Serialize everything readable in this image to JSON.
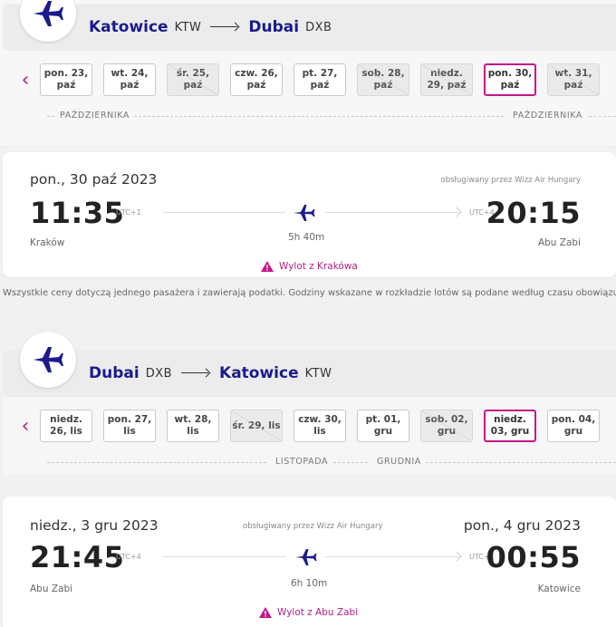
{
  "outbound": {
    "route": {
      "from_city": "Katowice",
      "from_code": "KTW",
      "to_city": "Dubai",
      "to_code": "DXB"
    },
    "days": [
      {
        "l1": "pon. 23,",
        "l2": "paź",
        "state": "normal"
      },
      {
        "l1": "wt. 24,",
        "l2": "paź",
        "state": "normal"
      },
      {
        "l1": "śr. 25,",
        "l2": "paź",
        "state": "disabled"
      },
      {
        "l1": "czw. 26,",
        "l2": "paź",
        "state": "normal"
      },
      {
        "l1": "pt. 27,",
        "l2": "paź",
        "state": "normal"
      },
      {
        "l1": "sob. 28,",
        "l2": "paź",
        "state": "disabled"
      },
      {
        "l1": "niedz.",
        "l2": "29, paź",
        "state": "disabled"
      },
      {
        "l1": "pon. 30,",
        "l2": "paź",
        "state": "selected"
      },
      {
        "l1": "wt. 31,",
        "l2": "paź",
        "state": "disabled"
      }
    ],
    "month_left": "PAŹDZIERNIKA",
    "month_right": "PAŹDZIERNIKA",
    "flight": {
      "date": "pon., 30 paź 2023",
      "operated_by": "obsługiwany przez Wizz Air Hungary",
      "dep_time": "11:35",
      "dep_tz": "UTC+1",
      "dep_place": "Kraków",
      "duration": "5h 40m",
      "arr_time": "20:15",
      "arr_tz": "UTC+4",
      "arr_place": "Abu Zabi",
      "warning": "Wylot z Krakówa"
    }
  },
  "note": "Wszystkie ceny dotyczą jednego pasażera i zawierają podatki. Godziny wskazane w rozkładzie lotów są podane według czasu obowiązują",
  "return": {
    "route": {
      "from_city": "Dubai",
      "from_code": "DXB",
      "to_city": "Katowice",
      "to_code": "KTW"
    },
    "days": [
      {
        "l1": "niedz.",
        "l2": "26, lis",
        "state": "normal"
      },
      {
        "l1": "pon. 27,",
        "l2": "lis",
        "state": "normal"
      },
      {
        "l1": "wt. 28,",
        "l2": "lis",
        "state": "normal"
      },
      {
        "l1": "śr. 29, lis",
        "l2": "",
        "state": "disabled"
      },
      {
        "l1": "czw. 30,",
        "l2": "lis",
        "state": "normal"
      },
      {
        "l1": "pt. 01,",
        "l2": "gru",
        "state": "normal"
      },
      {
        "l1": "sob. 02,",
        "l2": "gru",
        "state": "disabled"
      },
      {
        "l1": "niedz.",
        "l2": "03, gru",
        "state": "selected"
      },
      {
        "l1": "pon. 04,",
        "l2": "gru",
        "state": "normal"
      }
    ],
    "month_left": "LISTOPADA",
    "month_right": "GRUDNIA",
    "flight": {
      "date": "niedz., 3 gru 2023",
      "operated_by": "obsługiwany przez Wizz Air Hungary",
      "arr_date": "pon., 4 gru 2023",
      "dep_time": "21:45",
      "dep_tz": "UTC+4",
      "dep_place": "Abu Zabi",
      "duration": "6h 10m",
      "arr_time": "00:55",
      "arr_tz": "UTC+1",
      "arr_place": "Katowice",
      "warning": "Wylot z Abu Zabi"
    }
  },
  "colors": {
    "brand": "#1b1b8c",
    "accent": "#c7158a"
  }
}
